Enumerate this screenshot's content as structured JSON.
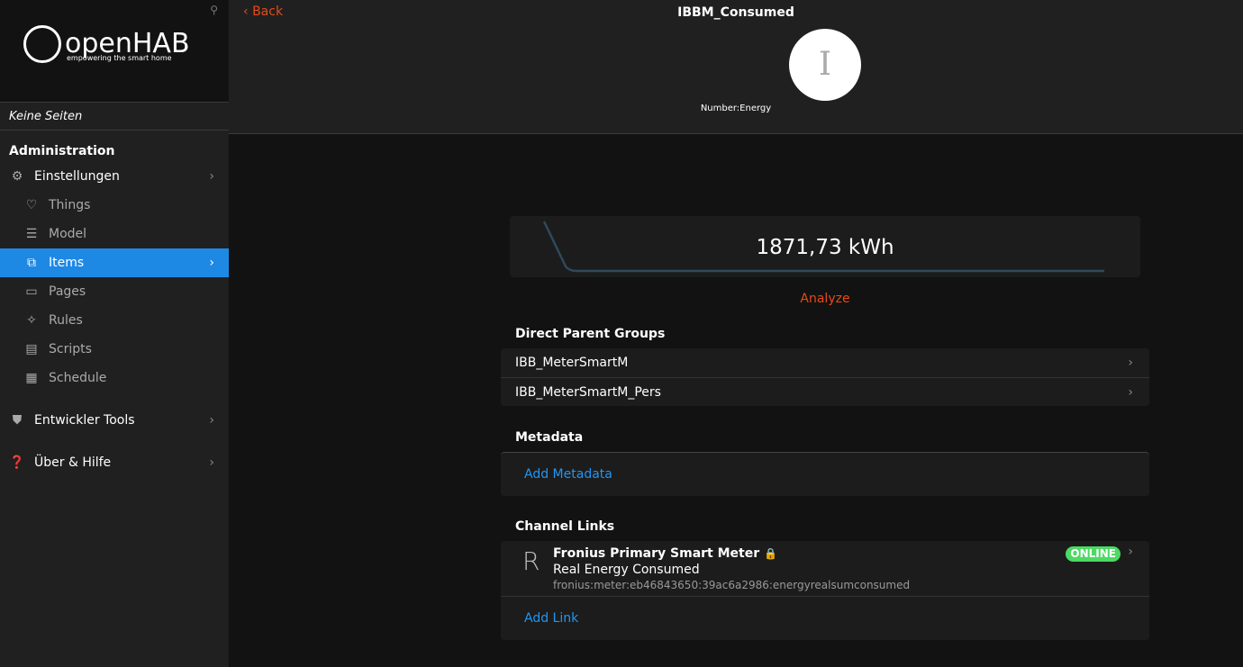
{
  "sidebar": {
    "logo_text": "openHAB",
    "logo_sub": "empowering the smart home",
    "no_pages": "Keine Seiten",
    "section": "Administration",
    "items": [
      {
        "label": "Einstellungen",
        "icon": "gear-icon"
      },
      {
        "label": "Things",
        "icon": "bulb-icon"
      },
      {
        "label": "Model",
        "icon": "list-icon"
      },
      {
        "label": "Items",
        "icon": "items-icon"
      },
      {
        "label": "Pages",
        "icon": "monitor-icon"
      },
      {
        "label": "Rules",
        "icon": "wand-icon"
      },
      {
        "label": "Scripts",
        "icon": "script-icon"
      },
      {
        "label": "Schedule",
        "icon": "calendar-icon"
      },
      {
        "label": "Entwickler Tools",
        "icon": "shield-icon"
      },
      {
        "label": "Über & Hilfe",
        "icon": "help-icon"
      }
    ]
  },
  "header": {
    "back": "Back",
    "title": "IBBM_Consumed",
    "avatar_letter": "I",
    "type": "Number:Energy"
  },
  "state": {
    "value": "1871,73 kWh",
    "analyze": "Analyze"
  },
  "parents": {
    "title": "Direct Parent Groups",
    "items": [
      "IBB_MeterSmartM",
      "IBB_MeterSmartM_Pers"
    ]
  },
  "metadata": {
    "title": "Metadata",
    "add": "Add Metadata"
  },
  "channels": {
    "title": "Channel Links",
    "letter": "R",
    "thing": "Fronius Primary Smart Meter",
    "channel": "Real Energy Consumed",
    "uid": "fronius:meter:eb46843650:39ac6a2986:energyrealsumconsumed",
    "status": "ONLINE",
    "add": "Add Link"
  },
  "colors": {
    "accent": "#1e88e5",
    "back": "#e64a19",
    "online": "#4cd964"
  }
}
